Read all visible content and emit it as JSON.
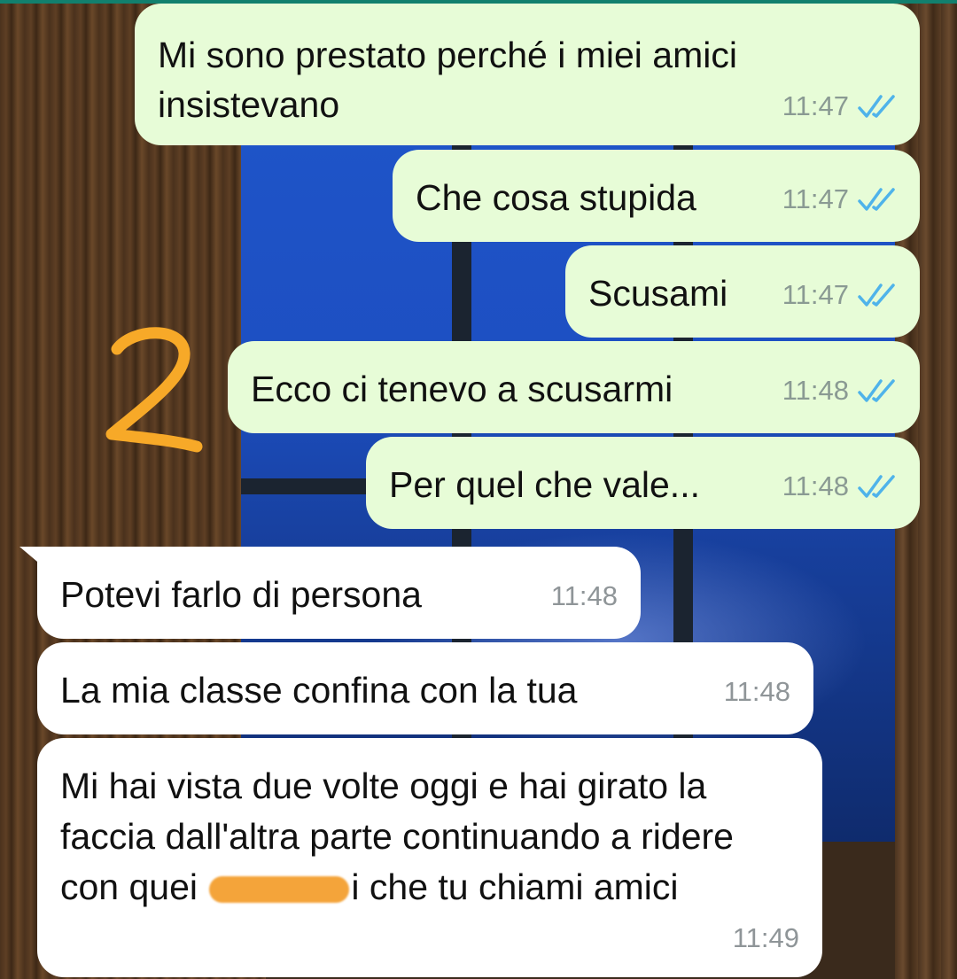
{
  "annotation": "2",
  "colors": {
    "outgoing_bubble": "#e7fcd7",
    "incoming_bubble": "#ffffff",
    "read_ticks": "#4fb3ea",
    "annotation_orange": "#f7a928"
  },
  "messages": [
    {
      "dir": "out",
      "text": "Mi sono prestato perché i miei amici insistevano",
      "time": "11:47",
      "status_icon": "double-check-read-icon"
    },
    {
      "dir": "out",
      "text": "Che cosa stupida",
      "time": "11:47",
      "status_icon": "double-check-read-icon"
    },
    {
      "dir": "out",
      "text": "Scusami",
      "time": "11:47",
      "status_icon": "double-check-read-icon"
    },
    {
      "dir": "out",
      "text": "Ecco ci tenevo a scusarmi",
      "time": "11:48",
      "status_icon": "double-check-read-icon"
    },
    {
      "dir": "out",
      "text": "Per quel che vale...",
      "time": "11:48",
      "status_icon": "double-check-read-icon"
    },
    {
      "dir": "in",
      "text": "Potevi farlo di persona",
      "time": "11:48"
    },
    {
      "dir": "in",
      "text": "La mia classe confina con la tua",
      "time": "11:48"
    },
    {
      "dir": "in",
      "text_before": "Mi hai vista due volte oggi e hai girato la faccia dall'altra parte continuando a ridere con quei ",
      "text_after": "i che tu chiami amici",
      "time": "11:49"
    }
  ]
}
